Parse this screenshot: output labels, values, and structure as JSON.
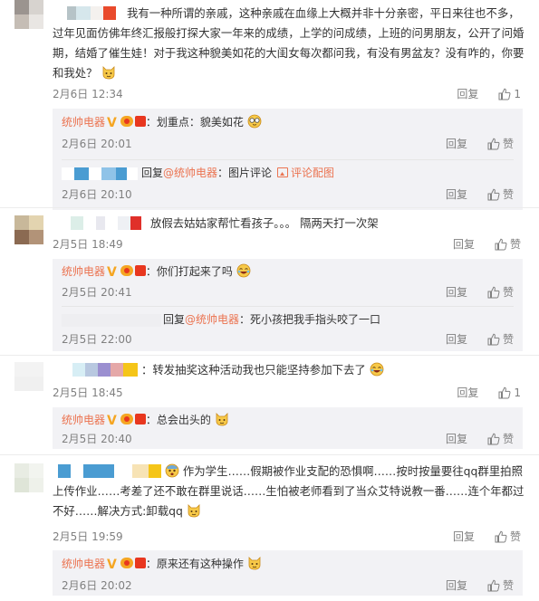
{
  "comments": [
    {
      "text": "我有一种所谓的亲戚，这种亲戚在血缘上大概并非十分亲密，平日来往也不多，过年见面仿佛年终汇报般打探大家一年来的成绩，上学的问成绩，上班的问男朋友，公开了问婚期，结婚了催生娃！对于我这种貌美如花的大闺女每次都问我，有没有男盆友？没有咋的，你要和我处？",
      "time": "2月6日 12:34",
      "reply": "回复",
      "likes": "1",
      "replies": [
        {
          "author": "统帅电器",
          "text": "：划重点：貌美如花",
          "time": "2月6日 20:01",
          "reply": "回复",
          "like": "赞"
        },
        {
          "prefix": "回复",
          "mention": "@统帅电器",
          "text": "：图片评论",
          "pic_link": "评论配图",
          "time": "2月6日 20:10",
          "reply": "回复",
          "like": "赞"
        }
      ]
    },
    {
      "text": "放假去姑姑家帮忙看孩子。。。 隔两天打一次架",
      "time": "2月5日 18:49",
      "reply": "回复",
      "like": "赞",
      "replies": [
        {
          "author": "统帅电器",
          "text": "：你们打起来了吗",
          "time": "2月5日 20:41",
          "reply": "回复",
          "like": "赞"
        },
        {
          "prefix": "回复",
          "mention": "@统帅电器",
          "text": "：死小孩把我手指头咬了一口",
          "time": "2月5日 22:00",
          "reply": "回复",
          "like": "赞"
        }
      ]
    },
    {
      "text": "：转发抽奖这种活动我也只能坚持参加下去了",
      "time": "2月5日 18:45",
      "reply": "回复",
      "likes": "1",
      "replies": [
        {
          "author": "统帅电器",
          "text": "：总会出头的",
          "time": "2月5日 20:40",
          "reply": "回复",
          "like": "赞"
        }
      ]
    },
    {
      "text": "作为学生……假期被作业支配的恐惧啊……按时按量要往qq群里拍照上传作业……考差了还不敢在群里说话……生怕被老师看到了当众艾特说教一番……连个年都过不好……解决方式:卸载qq",
      "time": "2月5日 19:59",
      "reply": "回复",
      "like": "赞",
      "replies": [
        {
          "author": "统帅电器",
          "text": "：原来还有这种操作",
          "time": "2月6日 20:02",
          "reply": "回复",
          "like": "赞"
        }
      ]
    }
  ]
}
